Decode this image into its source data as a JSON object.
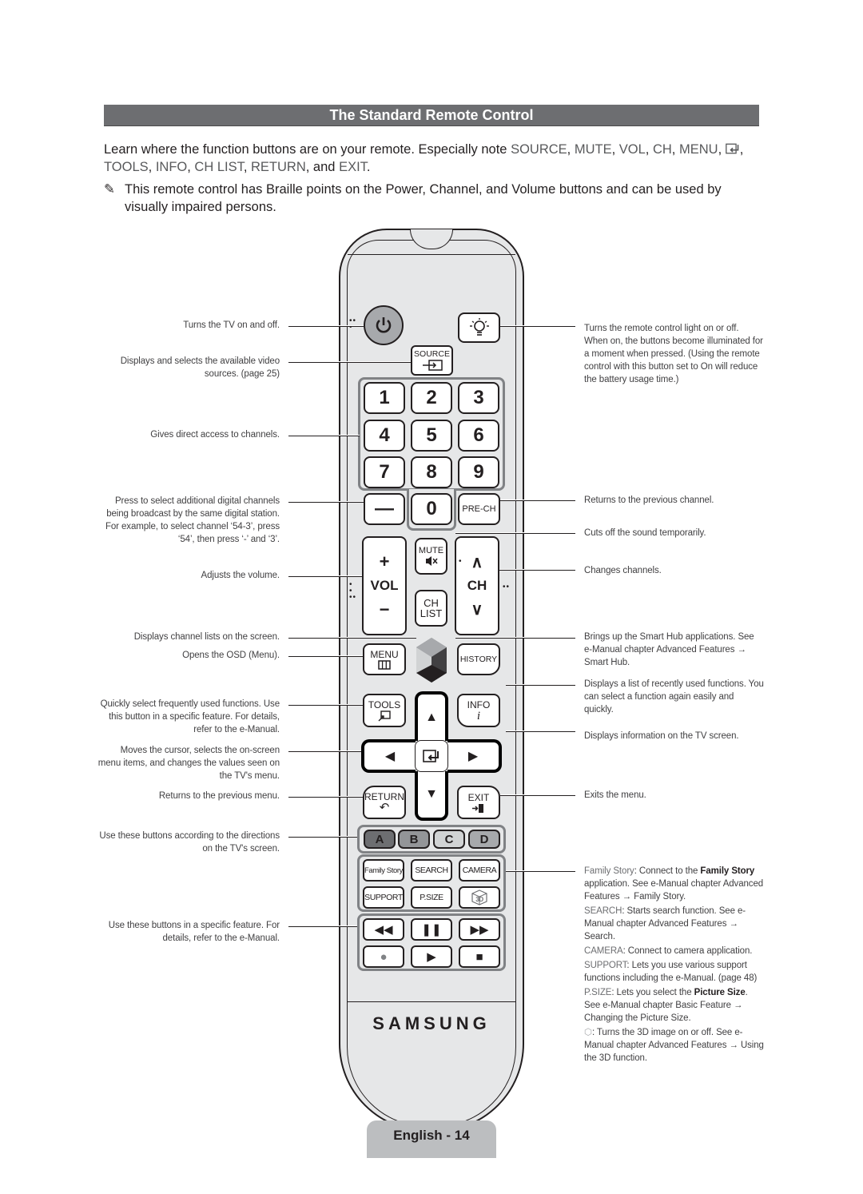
{
  "section_title": "The Standard Remote Control",
  "intro": {
    "lead": "Learn where the function buttons are on your remote. Especially note ",
    "keywords": [
      "SOURCE",
      "MUTE",
      "VOL",
      "CH",
      "MENU",
      "TOOLS",
      "INFO",
      "CH LIST",
      "RETURN",
      "EXIT"
    ],
    "sep": ", ",
    "and": ", and ",
    "end": "."
  },
  "note": {
    "icon": "✎",
    "text": "This remote control has Braille points on the Power, Channel, and Volume buttons and can be used by visually impaired persons."
  },
  "left_descriptions": [
    "Turns the TV on and off.",
    "Displays and selects the available video sources. (page 25)",
    "Gives direct access to channels.",
    "Press to select additional digital channels being broadcast by the same digital station. For example, to select channel ‘54-3’, press ‘54’, then press ‘-’ and ‘3’.",
    "Adjusts the volume.",
    "Displays channel lists on the screen.",
    "Opens the OSD (Menu).",
    "Quickly select frequently used functions. Use this button in a specific feature. For details, refer to the e-Manual.",
    "Moves the cursor, selects the on-screen menu items, and changes the values seen on the TV's menu.",
    "Returns to the previous menu.",
    "Use these buttons according to the directions on the TV's screen.",
    "Use these buttons in a specific feature. For details, refer to the e-Manual."
  ],
  "right_descriptions": [
    "Turns the remote control light on or off. When on, the buttons become illuminated for a moment when pressed. (Using the remote control with this button set to On will reduce the battery usage time.)",
    "Returns to the previous channel.",
    "Cuts off the sound temporarily.",
    "Changes channels.",
    "Brings up the Smart Hub applications. See e-Manual chapter Advanced Features → Smart Hub.",
    "Displays a list of recently used functions. You can select a function again easily and quickly.",
    "Displays information on the TV screen.",
    "Exits the menu."
  ],
  "feature_descriptions": [
    {
      "key": "Family Story",
      "pre": ": Connect to the ",
      "bold": "Family Story",
      "post": " application. See e-Manual chapter Advanced Features → Family Story."
    },
    {
      "key": "SEARCH",
      "pre": ": Starts search function. See e-Manual chapter Advanced Features → Search.",
      "bold": "",
      "post": ""
    },
    {
      "key": "CAMERA",
      "pre": ": Connect to camera application.",
      "bold": "",
      "post": ""
    },
    {
      "key": "SUPPORT",
      "pre": ": Lets you use various support functions including the e-Manual. (page 48)",
      "bold": "",
      "post": ""
    },
    {
      "key": "P.SIZE",
      "pre": ": Lets you select the ",
      "bold": "Picture Size",
      "post": ". See e-Manual chapter Basic Feature → Changing the Picture Size."
    },
    {
      "key": "3D-icon",
      "pre": ": Turns the 3D image on or off. See e-Manual chapter Advanced Features → Using the 3D function.",
      "bold": "",
      "post": ""
    }
  ],
  "remote": {
    "source_label": "SOURCE",
    "numbers": [
      "1",
      "2",
      "3",
      "4",
      "5",
      "6",
      "7",
      "8",
      "9"
    ],
    "dash": "—",
    "zero": "0",
    "prech": "PRE-CH",
    "vol": {
      "plus": "+",
      "label": "VOL",
      "minus": "−"
    },
    "mute": "MUTE",
    "chlist": [
      "CH",
      "LIST"
    ],
    "ch": {
      "up": "∧",
      "label": "CH",
      "down": "∨"
    },
    "menu": "MENU",
    "history": "HISTORY",
    "tools": "TOOLS",
    "info": "INFO",
    "info_glyph": "i",
    "return": "RETURN",
    "exit": "EXIT",
    "colors": [
      {
        "label": "A",
        "color": "#6d6e71"
      },
      {
        "label": "B",
        "color": "#939598"
      },
      {
        "label": "C",
        "color": "#d1d3d4"
      },
      {
        "label": "D",
        "color": "#a7a9ac"
      }
    ],
    "functions": [
      "Family Story",
      "SEARCH",
      "CAMERA",
      "SUPPORT",
      "P.SIZE",
      "3D"
    ],
    "media": [
      "◀◀",
      "❚❚",
      "▶▶",
      "●",
      "▶",
      "■"
    ],
    "brand": "SAMSUNG"
  },
  "footer": "English - 14"
}
